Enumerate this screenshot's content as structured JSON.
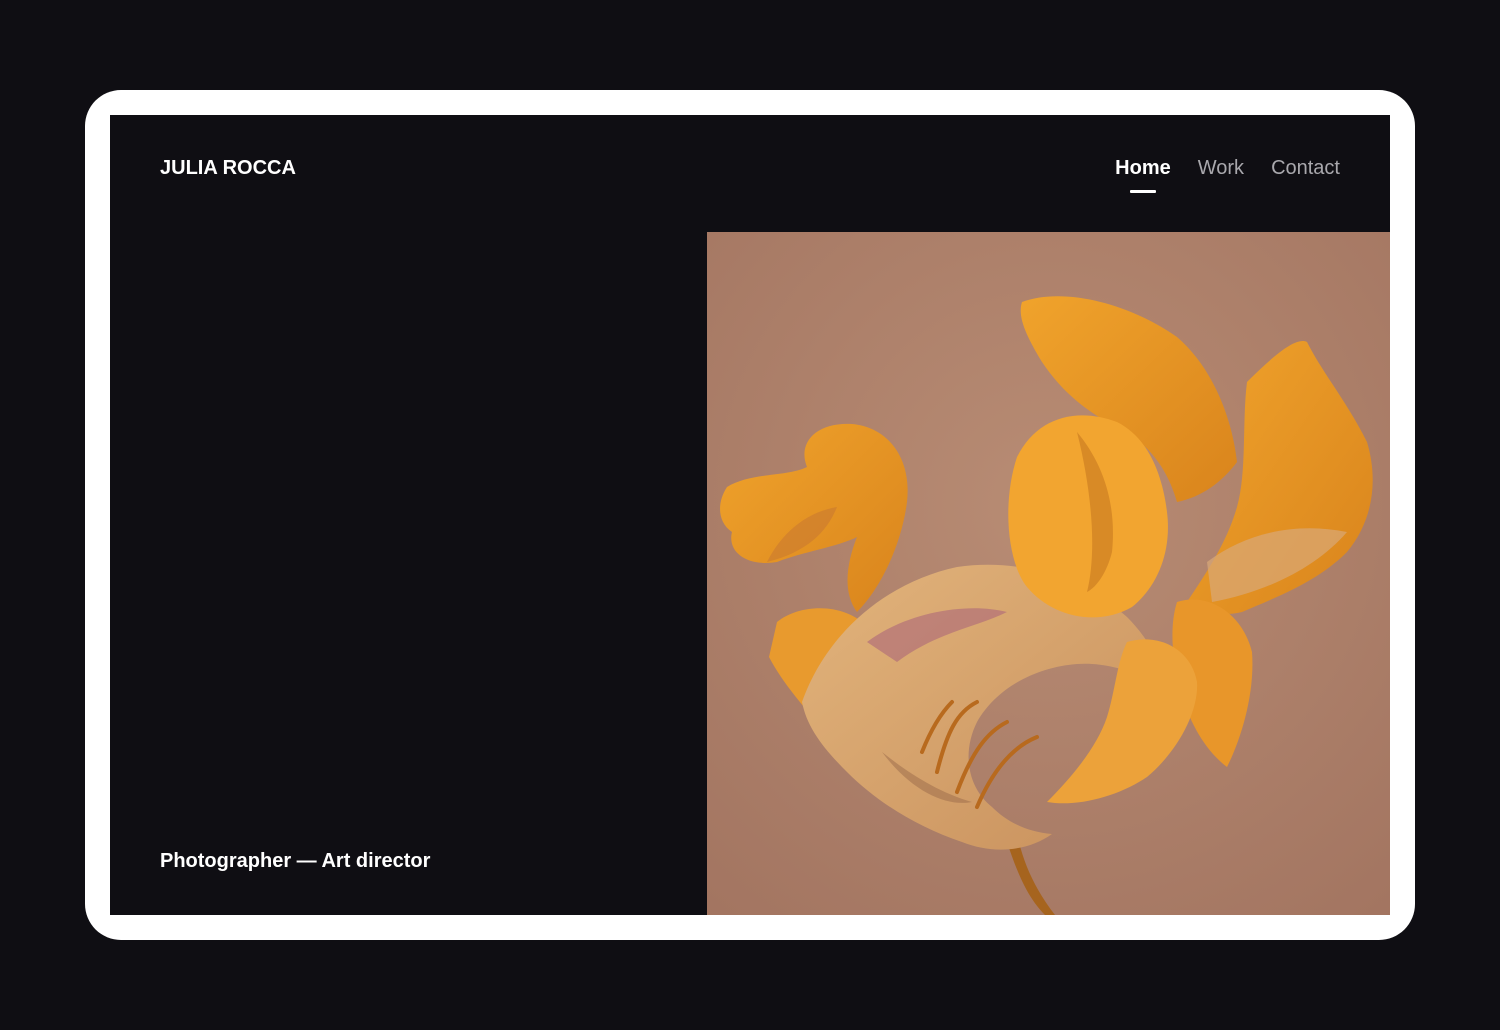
{
  "header": {
    "logo": "JULIA ROCCA",
    "nav": [
      {
        "label": "Home",
        "active": true
      },
      {
        "label": "Work",
        "active": false
      },
      {
        "label": "Contact",
        "active": false
      }
    ]
  },
  "main": {
    "tagline": "Photographer — Art director",
    "hero_image": {
      "subject": "dried orange tulip",
      "background_color": "#b0846d"
    }
  },
  "colors": {
    "page_background": "#0f0e13",
    "frame": "#ffffff",
    "text": "#ffffff",
    "nav_inactive": "#a9a8ad"
  }
}
